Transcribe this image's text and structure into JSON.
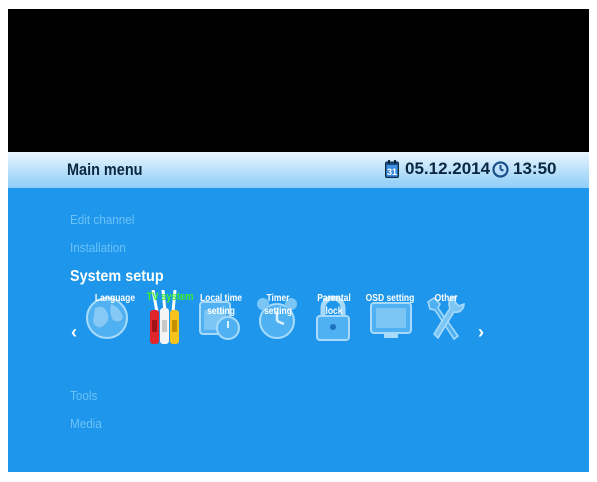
{
  "header": {
    "title": "Main menu",
    "date": "05.12.2014",
    "time": "13:50"
  },
  "menu": {
    "items": [
      {
        "label": "Edit channel"
      },
      {
        "label": "Installation"
      },
      {
        "label": "System setup"
      },
      {
        "label": "Tools"
      },
      {
        "label": "Media"
      }
    ],
    "active_index": 2
  },
  "system_setup": {
    "nav_left": "‹",
    "nav_right": "›",
    "items": [
      {
        "label": "Language",
        "icon": "globe-icon"
      },
      {
        "label": "TV system",
        "icon": "av-cables-icon"
      },
      {
        "label": "Local time setting",
        "icon": "calendar-clock-icon"
      },
      {
        "label": "Timer setting",
        "icon": "alarm-clock-icon"
      },
      {
        "label": "Parental lock",
        "icon": "padlock-icon"
      },
      {
        "label": "OSD setting",
        "icon": "osd-screen-icon"
      },
      {
        "label": "Other",
        "icon": "tools-icon"
      }
    ],
    "selected_index": 1
  },
  "colors": {
    "background": "#1e96ec",
    "header_bar": "#bfe3fb",
    "inactive_text": "#6cc2f7",
    "selected_text": "#3ef02a"
  }
}
